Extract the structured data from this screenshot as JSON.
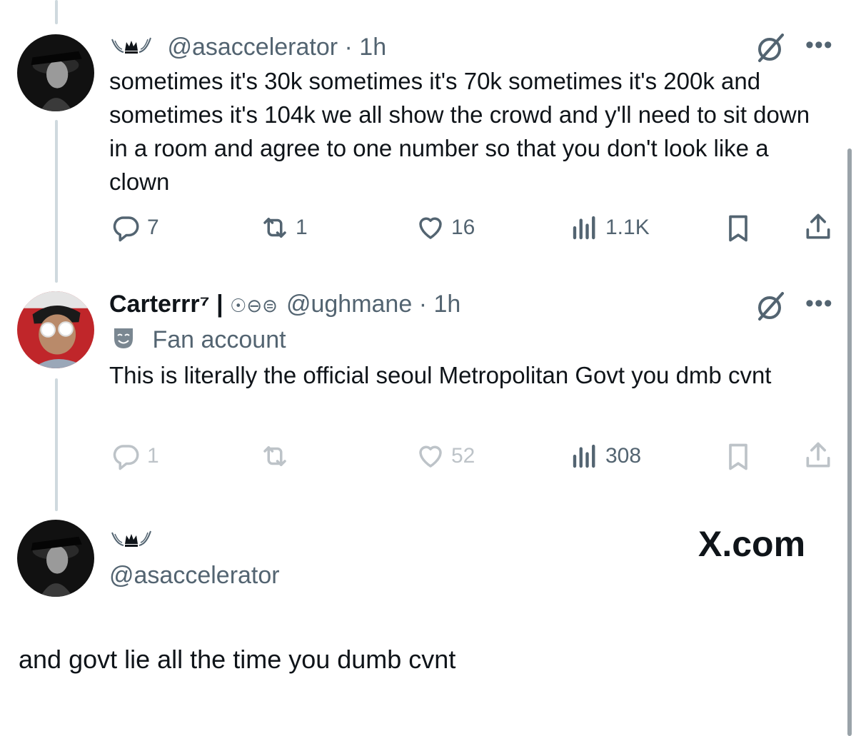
{
  "tweets": [
    {
      "handle": "@asaccelerator",
      "time": "· 1h",
      "text": "sometimes it's 30k sometimes it's 70k sometimes it's 200k and sometimes it's 104k we all show the crowd and y'll need to sit down in a room and agree to one number so that you don't look like a clown",
      "replies": "7",
      "reposts": "1",
      "likes": "16",
      "views": "1.1K"
    },
    {
      "display_name": "Carterrr⁷ | ",
      "badges": "☉⊖⊜",
      "handle": "@ughmane",
      "time": "· 1h",
      "label": "Fan account",
      "text": "This is literally the official seoul Metropolitan Govt you dmb cvnt",
      "replies": "1",
      "reposts": "",
      "likes": "52",
      "views": "308"
    }
  ],
  "reply_card": {
    "handle": "@asaccelerator",
    "brand": "X.com",
    "text": "and govt lie all the time you dumb cvnt"
  },
  "colors": {
    "text": "#0f1419",
    "muted": "#536471",
    "thread_line": "#cfd9de"
  },
  "icons": [
    "crown-wings-icon",
    "grok-icon",
    "more-icon",
    "reply-icon",
    "repost-icon",
    "like-icon",
    "views-icon",
    "bookmark-icon",
    "share-icon",
    "theater-mask-icon"
  ]
}
